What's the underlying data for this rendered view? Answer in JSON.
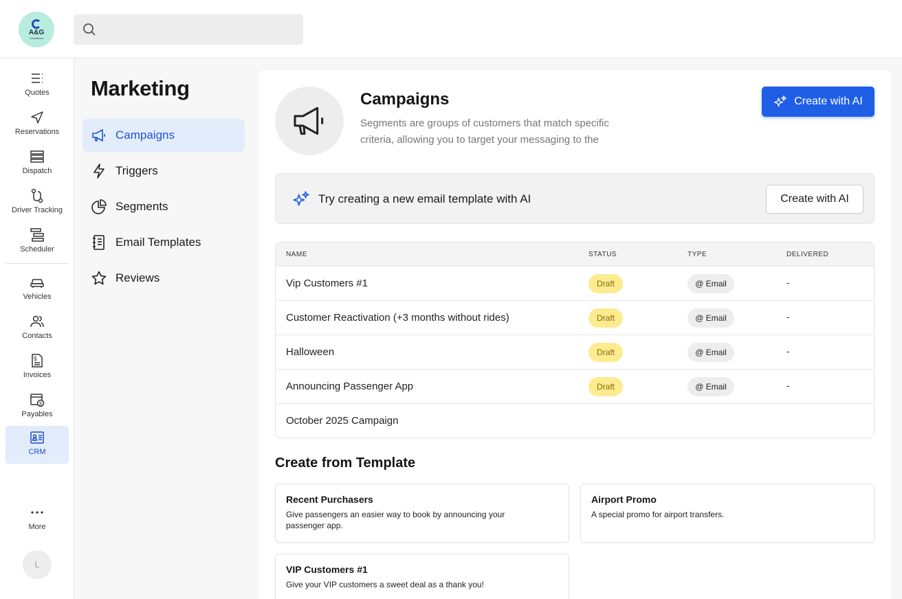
{
  "brand": {
    "logo_line1": "A&G",
    "logo_line2": "Chauffeurs"
  },
  "search": {
    "placeholder": ""
  },
  "rail": {
    "items": [
      {
        "label": "Quotes",
        "icon": "list-icon"
      },
      {
        "label": "Reservations",
        "icon": "send-icon"
      },
      {
        "label": "Dispatch",
        "icon": "stack-icon"
      },
      {
        "label": "Driver Tracking",
        "icon": "route-icon"
      },
      {
        "label": "Scheduler",
        "icon": "gantt-icon"
      },
      {
        "label": "Vehicles",
        "icon": "car-icon"
      },
      {
        "label": "Contacts",
        "icon": "users-icon"
      },
      {
        "label": "Invoices",
        "icon": "invoice-icon"
      },
      {
        "label": "Payables",
        "icon": "payables-icon"
      },
      {
        "label": "CRM",
        "icon": "crm-icon",
        "active": true
      },
      {
        "label": "More",
        "icon": "more-icon"
      }
    ],
    "avatar_initial": "L"
  },
  "subnav": {
    "title": "Marketing",
    "items": [
      {
        "label": "Campaigns",
        "icon": "megaphone-icon",
        "active": true
      },
      {
        "label": "Triggers",
        "icon": "lightning-icon"
      },
      {
        "label": "Segments",
        "icon": "pie-chart-icon"
      },
      {
        "label": "Email Templates",
        "icon": "notebook-icon"
      },
      {
        "label": "Reviews",
        "icon": "star-icon"
      }
    ]
  },
  "hero": {
    "title": "Campaigns",
    "description": "Segments are groups of customers that match specific criteria, allowing you to target your messaging to the",
    "create_ai_label": "Create with AI"
  },
  "ai_banner": {
    "text": "Try creating a new email template with AI",
    "button_label": "Create with AI"
  },
  "table": {
    "headers": {
      "name": "NAME",
      "status": "STATUS",
      "type": "TYPE",
      "delivered": "DELIVERED"
    },
    "rows": [
      {
        "name": "Vip Customers #1",
        "status": "Draft",
        "type": "@ Email",
        "delivered": "-"
      },
      {
        "name": "Customer Reactivation (+3 months without rides)",
        "status": "Draft",
        "type": "@ Email",
        "delivered": "-"
      },
      {
        "name": "Halloween",
        "status": "Draft",
        "type": "@ Email",
        "delivered": "-"
      },
      {
        "name": "Announcing Passenger App",
        "status": "Draft",
        "type": "@ Email",
        "delivered": "-"
      },
      {
        "name": "October 2025 Campaign",
        "status": "",
        "type": "",
        "delivered": ""
      }
    ]
  },
  "templates": {
    "title": "Create from Template",
    "cards": [
      {
        "title": "Recent Purchasers",
        "description": "Give passengers an easier way to book by announcing your passenger app."
      },
      {
        "title": "Airport Promo",
        "description": "A special promo for airport transfers."
      },
      {
        "title": "VIP Customers #1",
        "description": "Give your VIP customers a sweet deal as a thank you!"
      }
    ]
  },
  "colors": {
    "accent": "#1f5fe6",
    "active_bg": "#e3ecfb",
    "draft_bg": "#fdeb8f",
    "logo_bg": "#b8ecde"
  }
}
